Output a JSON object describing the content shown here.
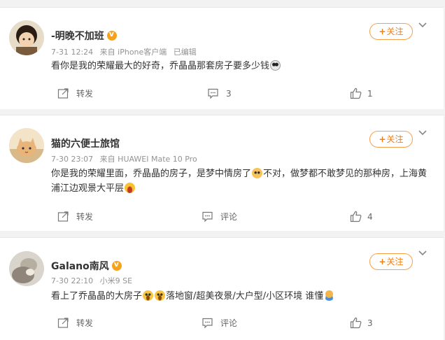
{
  "comments": [
    {
      "name": "-明晚不加班",
      "has_vip_badge": true,
      "meta": [
        "7-31 12:24",
        "来自 iPhone客户端",
        "已编辑"
      ],
      "text_before": "看你是我的荣耀最大的好奇，乔晶晶那套房子要多少钱",
      "emoji1": "panda-emoji",
      "text_middle": "",
      "emoji2": "",
      "text_after": "",
      "follow_label": "关注",
      "actions": {
        "share": "转发",
        "comment": "3",
        "like": "1"
      }
    },
    {
      "name": "猫的六便士旅馆",
      "has_vip_badge": false,
      "meta": [
        "7-30 23:07",
        "来自 HUAWEI Mate 10 Pro"
      ],
      "text_before": "你是我的荣耀里面，乔晶晶的房子，是梦中情房了",
      "emoji1": "dog-emoji",
      "text_middle": "不对，做梦都不敢梦见的那种房，上海黄浦江边观景大平层",
      "emoji2": "laugh-emoji",
      "text_after": "",
      "follow_label": "关注",
      "actions": {
        "share": "转发",
        "comment": "评论",
        "like": "4"
      }
    },
    {
      "name": "Galano南风",
      "has_vip_badge": true,
      "meta": [
        "7-30 22:10",
        "小米9 SE"
      ],
      "text_before": "看上了乔晶晶的大房子",
      "emoji1": "drool-emoji",
      "text_middle": "",
      "emoji2": "drool-emoji",
      "text_after": "落地窗/超美夜景/大户型/小区环境 谁懂",
      "emoji3": "think-emoji",
      "follow_label": "关注",
      "actions": {
        "share": "转发",
        "comment": "评论",
        "like": "3"
      }
    }
  ],
  "icons": {
    "share": "share-icon",
    "comment": "comment-icon",
    "like": "like-icon",
    "more": "chevron-down-icon"
  },
  "colors": {
    "accent": "#f07f14",
    "follow_border": "#f7a04b",
    "meta_text": "#939393",
    "background": "#f2f2f2"
  }
}
